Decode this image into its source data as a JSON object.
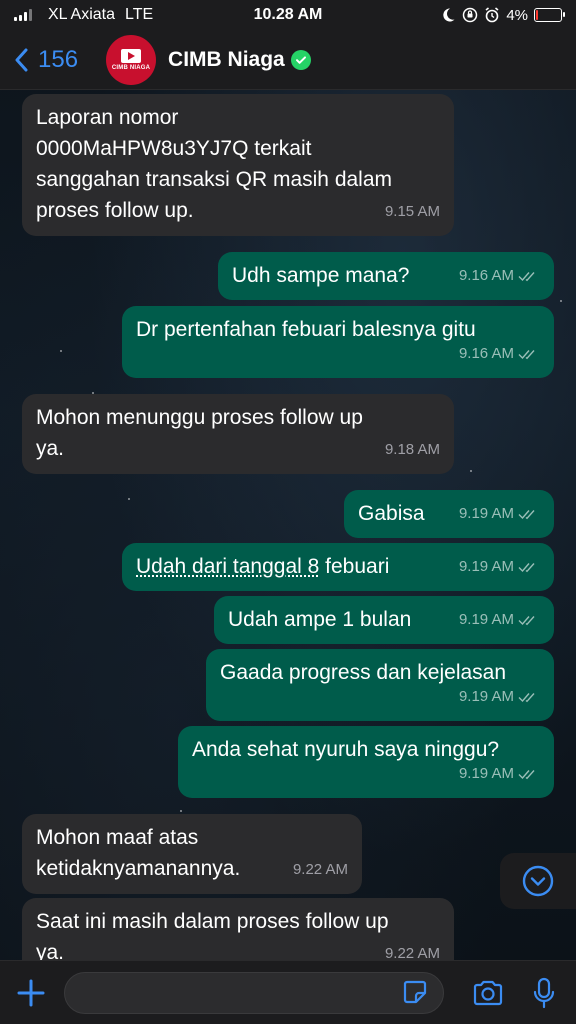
{
  "status_bar": {
    "carrier": "XL Axiata",
    "network": "LTE",
    "time": "10.28 AM",
    "battery": "4%",
    "battery_level": 0.04
  },
  "header": {
    "back_count": "156",
    "contact_name": "CIMB Niaga",
    "avatar_text": "CIMB NIAGA"
  },
  "messages": [
    {
      "dir": "in",
      "text": "Laporan nomor\n0000MaHPW8u3YJ7Q terkait\nsanggahan transaksi QR masih dalam\nproses follow up.",
      "time": "9.15 AM"
    },
    {
      "dir": "out",
      "text": "Udh sampe mana?",
      "time": "9.16 AM"
    },
    {
      "dir": "out",
      "text": "Dr pertenfahan febuari balesnya gitu",
      "time": "9.16 AM"
    },
    {
      "dir": "in",
      "text": "Mohon menunggu proses follow up\nya.",
      "time": "9.18 AM"
    },
    {
      "dir": "out",
      "text": "Gabisa",
      "time": "9.19 AM"
    },
    {
      "dir": "out",
      "text": "Udah dari tanggal 8 febuari",
      "time": "9.19 AM"
    },
    {
      "dir": "out",
      "text": "Udah ampe 1 bulan",
      "time": "9.19 AM"
    },
    {
      "dir": "out",
      "text": "Gaada progress dan kejelasan",
      "time": "9.19 AM"
    },
    {
      "dir": "out",
      "text": "Anda sehat nyuruh saya ninggu?",
      "time": "9.19 AM"
    },
    {
      "dir": "in",
      "text": "Mohon maaf atas\nketidaknyamanannya.",
      "time": "9.22 AM"
    },
    {
      "dir": "in",
      "text": "Saat ini masih dalam proses follow up\nya.",
      "time": "9.22 AM"
    }
  ],
  "composer": {
    "value": "",
    "placeholder": ""
  },
  "colors": {
    "incoming_bubble": "#2b2b2d",
    "outgoing_bubble": "#005c4b",
    "accent": "#3b8cf2",
    "brand": "#c8102e",
    "verified": "#25d366"
  },
  "icons": [
    "back-chevron-icon",
    "verified-icon",
    "add-icon",
    "sticker-icon",
    "camera-icon",
    "microphone-icon",
    "chevron-down-icon",
    "double-check-icon"
  ]
}
